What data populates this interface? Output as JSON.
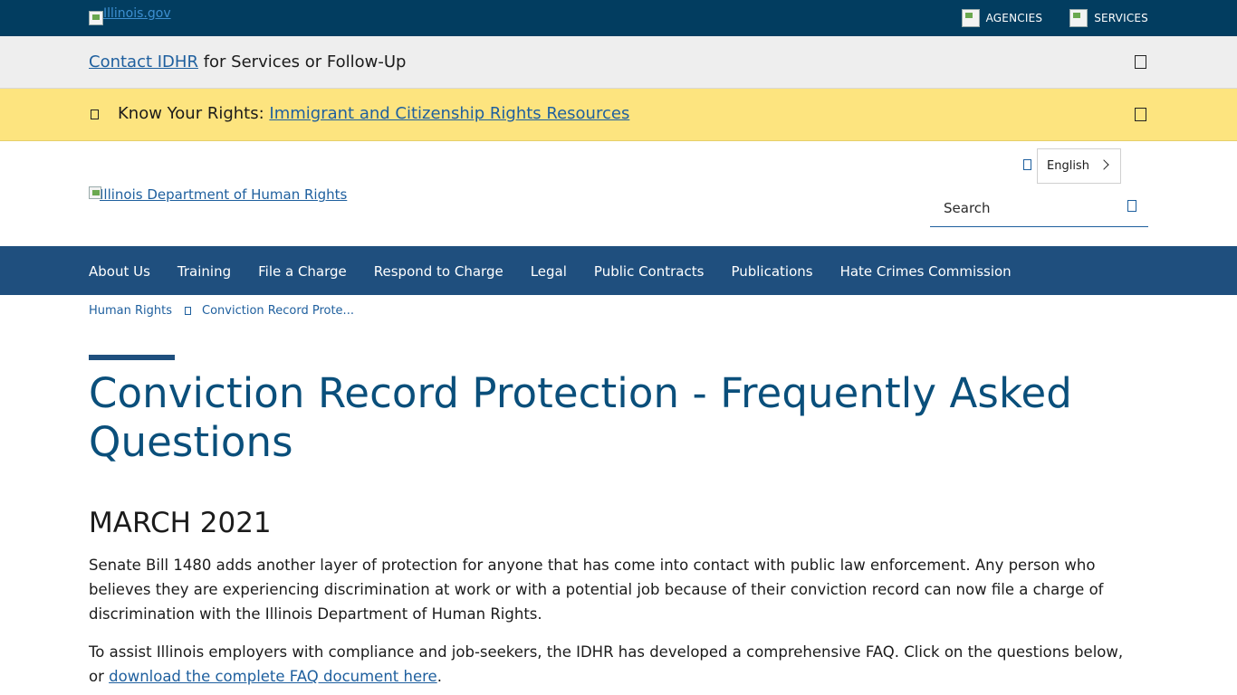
{
  "statebar": {
    "logo_alt": "Illinois.gov",
    "links": [
      {
        "label": "AGENCIES",
        "icon": "agencies-icon"
      },
      {
        "label": "SERVICES",
        "icon": "services-icon"
      }
    ]
  },
  "contact_bar": {
    "link": "Contact IDHR",
    "text": " for Services or Follow-Up"
  },
  "alert_bar": {
    "prefix": "Know Your Rights: ",
    "link": "Immigrant and Citizenship Rights Resources"
  },
  "header": {
    "logo_alt": "Illinois Department of Human Rights",
    "language": "English",
    "search_placeholder": "Search"
  },
  "nav": {
    "items": [
      "About Us",
      "Training",
      "File a Charge",
      "Respond to Charge",
      "Legal",
      "Public Contracts",
      "Publications",
      "Hate Crimes Commission"
    ]
  },
  "breadcrumb": {
    "items": [
      "Human Rights",
      "Conviction Record Prote..."
    ]
  },
  "page": {
    "title": "Conviction Record Protection - Frequently Asked Questions",
    "subheading": "MARCH 2021",
    "para1": "Senate Bill 1480 adds another layer of protection for anyone that has come into contact with public law enforcement. Any person who believes they are experiencing discrimination at work or with a potential job because of their conviction record can now file a charge of discrimination with the Illinois Department of Human Rights.",
    "para2_text": "To assist Illinois employers with compliance and job-seekers, the IDHR has developed a comprehensive FAQ. Click on the questions below, or ",
    "para2_link": "download the complete FAQ document here",
    "para2_end": "."
  },
  "colors": {
    "statebar": "#023d60",
    "nav": "#1f4f7e",
    "alert": "#fde47f",
    "link": "#1e5f9e",
    "title": "#0a4f7b"
  }
}
